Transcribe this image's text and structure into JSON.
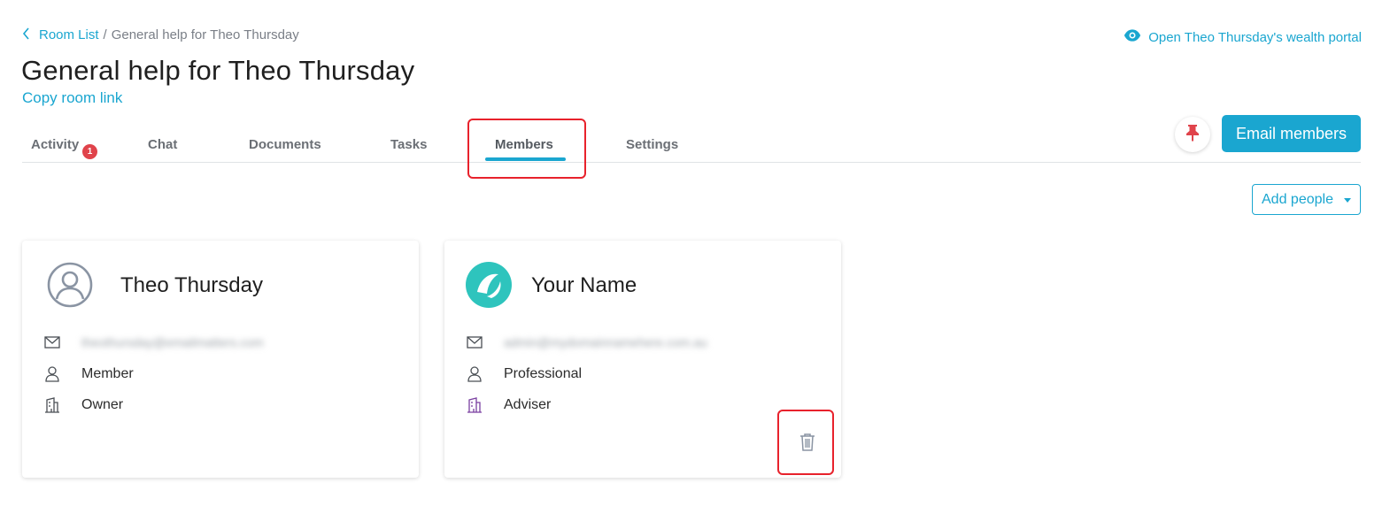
{
  "breadcrumb": {
    "back_label": "Room List",
    "separator": "/",
    "current": "General help for Theo Thursday"
  },
  "header": {
    "portal_link": "Open Theo Thursday's wealth portal",
    "title": "General help for Theo Thursday",
    "copy_link": "Copy room link"
  },
  "tabs": [
    {
      "label": "Activity",
      "badge": "1"
    },
    {
      "label": "Chat"
    },
    {
      "label": "Documents"
    },
    {
      "label": "Tasks"
    },
    {
      "label": "Members",
      "active": true
    },
    {
      "label": "Settings"
    }
  ],
  "actions": {
    "email_members": "Email members",
    "add_people": "Add people",
    "pin_icon": "pin-icon"
  },
  "members": [
    {
      "name": "Theo Thursday",
      "email": "theothursday@emailmatters.com",
      "role": "Member",
      "title": "Owner",
      "avatar": "user-circle-icon"
    },
    {
      "name": "Your Name",
      "email": "admin@mydomainnamehere.com.au",
      "role": "Professional",
      "title": "Adviser",
      "avatar": "company-logo"
    }
  ],
  "colors": {
    "accent": "#1aa6d0",
    "badge": "#e0434b",
    "pin": "#e0434b",
    "highlight": "#e8222c",
    "logo": "#2ec4bd"
  }
}
